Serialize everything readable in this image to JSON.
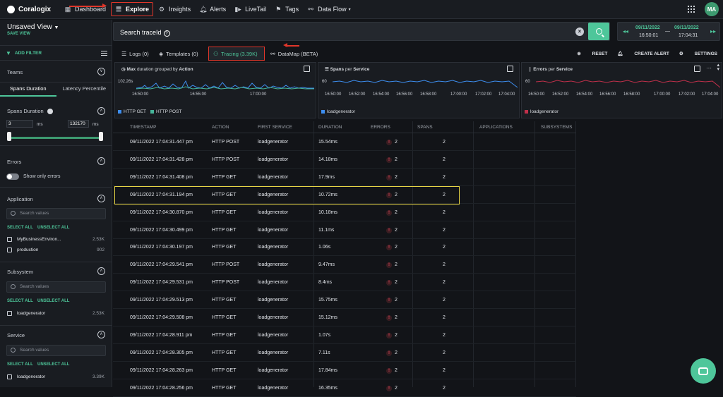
{
  "app": {
    "name": "Coralogix"
  },
  "nav": [
    {
      "label": "Dashboard",
      "icon": "dashboard-icon"
    },
    {
      "label": "Explore",
      "icon": "explore-icon"
    },
    {
      "label": "Insights",
      "icon": "insights-icon"
    },
    {
      "label": "Alerts",
      "icon": "bell-icon"
    },
    {
      "label": "LiveTail",
      "icon": "livetail-icon"
    },
    {
      "label": "Tags",
      "icon": "tags-icon"
    },
    {
      "label": "Data Flow",
      "icon": "dataflow-icon"
    }
  ],
  "user": {
    "initials": "MA"
  },
  "sidebar": {
    "view_title": "Unsaved View",
    "save_view": "SAVE VIEW",
    "add_filter": "ADD FILTER",
    "teams": "Teams",
    "tabs": [
      "Spans Duration",
      "Latency Percentile"
    ],
    "spans_duration": {
      "label": "Spans Duration",
      "min": "3",
      "max": "132170",
      "unit": "ms"
    },
    "errors": {
      "label": "Errors",
      "toggle_label": "Show only errors"
    },
    "application": {
      "label": "Application",
      "placeholder": "Search values",
      "select_all": "SELECT ALL",
      "unselect_all": "UNSELECT ALL",
      "items": [
        {
          "name": "MyBusinessEnviron...",
          "count": "2.53K"
        },
        {
          "name": "production",
          "count": "902"
        }
      ]
    },
    "subsystem": {
      "label": "Subsystem",
      "placeholder": "Search values",
      "select_all": "SELECT ALL",
      "unselect_all": "UNSELECT ALL",
      "items": [
        {
          "name": "loadgenerator",
          "count": "2.53K"
        }
      ]
    },
    "service": {
      "label": "Service",
      "placeholder": "Search values",
      "select_all": "SELECT ALL",
      "unselect_all": "UNSELECT ALL",
      "items": [
        {
          "name": "loadgenerator",
          "count": "3.39K"
        }
      ]
    }
  },
  "search": {
    "label": "Search traceId"
  },
  "daterange": {
    "from_date": "09/11/2022",
    "from_time": "16:50:01",
    "to_date": "09/11/2022",
    "to_time": "17:04:31",
    "sep": "—"
  },
  "tabs": [
    {
      "label": "Logs (0)"
    },
    {
      "label": "Templates (0)"
    },
    {
      "label": "Tracing (3.39K)"
    },
    {
      "label": "DataMap (BETA)"
    }
  ],
  "actions": {
    "reset": "RESET",
    "create_alert": "CREATE ALERT",
    "settings": "SETTINGS"
  },
  "widgets": [
    {
      "title_bold": "Max",
      "title_mid": "duration grouped by",
      "title_end": "Action",
      "y_label": "102.26s",
      "x_ticks": [
        "16:50:00",
        "16:55:00",
        "17:00:00"
      ],
      "legend": [
        {
          "name": "HTTP GET",
          "color": "#3d8ef0"
        },
        {
          "name": "HTTP POST",
          "color": "#46b59a"
        }
      ]
    },
    {
      "title_bold": "Spans",
      "title_mid": "per",
      "title_end": "Service",
      "y_label": "60",
      "x_ticks": [
        "16:50:00",
        "16:52:00",
        "16:54:00",
        "16:56:00",
        "16:58:00",
        "17:00:00",
        "17:02:00",
        "17:04:00"
      ],
      "legend": [
        {
          "name": "loadgenerator",
          "color": "#3d8ef0"
        }
      ]
    },
    {
      "title_bold": "Errors",
      "title_mid": "per",
      "title_end": "Service",
      "y_label": "60",
      "x_ticks": [
        "16:50:00",
        "16:52:00",
        "16:54:00",
        "16:56:00",
        "16:58:00",
        "17:00:00",
        "17:02:00",
        "17:04:00"
      ],
      "legend": [
        {
          "name": "loadgenerator",
          "color": "#c0304a"
        }
      ]
    }
  ],
  "table": {
    "columns": [
      "TIMESTAMP",
      "ACTION",
      "FIRST SERVICE",
      "DURATION",
      "ERRORS",
      "SPANS",
      "APPLICATIONS",
      "SUBSYSTEMS"
    ],
    "rows": [
      {
        "ts": "09/11/2022 17:04:31.447 pm",
        "action": "HTTP POST",
        "service": "loadgenerator",
        "duration": "15.54ms",
        "errors": "2",
        "spans": "2"
      },
      {
        "ts": "09/11/2022 17:04:31.428 pm",
        "action": "HTTP POST",
        "service": "loadgenerator",
        "duration": "14.18ms",
        "errors": "2",
        "spans": "2"
      },
      {
        "ts": "09/11/2022 17:04:31.408 pm",
        "action": "HTTP GET",
        "service": "loadgenerator",
        "duration": "17.9ms",
        "errors": "2",
        "spans": "2"
      },
      {
        "ts": "09/11/2022 17:04:31.194 pm",
        "action": "HTTP GET",
        "service": "loadgenerator",
        "duration": "10.72ms",
        "errors": "2",
        "spans": "2"
      },
      {
        "ts": "09/11/2022 17:04:30.870 pm",
        "action": "HTTP GET",
        "service": "loadgenerator",
        "duration": "10.18ms",
        "errors": "2",
        "spans": "2"
      },
      {
        "ts": "09/11/2022 17:04:30.499 pm",
        "action": "HTTP GET",
        "service": "loadgenerator",
        "duration": "11.1ms",
        "errors": "2",
        "spans": "2"
      },
      {
        "ts": "09/11/2022 17:04:30.197 pm",
        "action": "HTTP GET",
        "service": "loadgenerator",
        "duration": "1.06s",
        "errors": "2",
        "spans": "2"
      },
      {
        "ts": "09/11/2022 17:04:29.541 pm",
        "action": "HTTP POST",
        "service": "loadgenerator",
        "duration": "9.47ms",
        "errors": "2",
        "spans": "2"
      },
      {
        "ts": "09/11/2022 17:04:29.531 pm",
        "action": "HTTP POST",
        "service": "loadgenerator",
        "duration": "8.4ms",
        "errors": "2",
        "spans": "2"
      },
      {
        "ts": "09/11/2022 17:04:29.513 pm",
        "action": "HTTP GET",
        "service": "loadgenerator",
        "duration": "15.75ms",
        "errors": "2",
        "spans": "2"
      },
      {
        "ts": "09/11/2022 17:04:29.508 pm",
        "action": "HTTP GET",
        "service": "loadgenerator",
        "duration": "15.12ms",
        "errors": "2",
        "spans": "2"
      },
      {
        "ts": "09/11/2022 17:04:28.911 pm",
        "action": "HTTP GET",
        "service": "loadgenerator",
        "duration": "1.07s",
        "errors": "2",
        "spans": "2"
      },
      {
        "ts": "09/11/2022 17:04:28.305 pm",
        "action": "HTTP GET",
        "service": "loadgenerator",
        "duration": "7.11s",
        "errors": "2",
        "spans": "2"
      },
      {
        "ts": "09/11/2022 17:04:28.263 pm",
        "action": "HTTP GET",
        "service": "loadgenerator",
        "duration": "17.84ms",
        "errors": "2",
        "spans": "2"
      },
      {
        "ts": "09/11/2022 17:04:28.256 pm",
        "action": "HTTP GET",
        "service": "loadgenerator",
        "duration": "16.35ms",
        "errors": "2",
        "spans": "2"
      }
    ]
  },
  "colors": {
    "accent": "#4ec69a",
    "annotation_red": "#e0362a",
    "highlight_yellow": "#e6d445"
  }
}
